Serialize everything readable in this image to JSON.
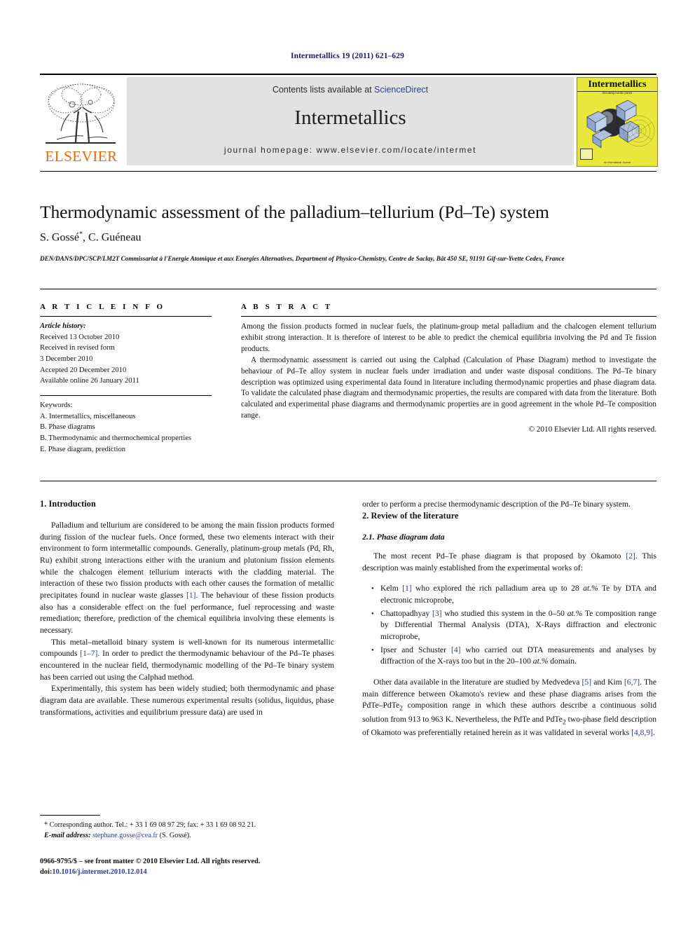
{
  "running_head": "Intermetallics 19 (2011) 621–629",
  "masthead": {
    "publisher_name": "ELSEVIER",
    "contents_prefix": "Contents lists available at ",
    "contents_link": "ScienceDirect",
    "journal_title": "Intermetallics",
    "homepage": "journal homepage: www.elsevier.com/locate/intermet",
    "cover": {
      "title": "Intermetallics",
      "subtitle": "including nordic pores",
      "footer": "An International Journal"
    },
    "link_color": "#2b3f9c",
    "banner_color": "#e2e2e2",
    "cover_color": "#e9e73c",
    "elsevier_orange": "#ec6608"
  },
  "article": {
    "title": "Thermodynamic assessment of the palladium–tellurium (Pd–Te) system",
    "authors": "S. Gossé",
    "authors_star": "*",
    "authors_rest": ", C. Guéneau",
    "affiliation": "DEN/DANS/DPC/SCP/LM2T Commissariat à l'Energie Atomique et aux Energies Alternatives, Department of Physico-Chemistry, Centre de Saclay, Bât 450 SE, 91191 Gif-sur-Yvette Cedex, France"
  },
  "info": {
    "heading": "A R T I C L E   I N F O",
    "history_label": "Article history:",
    "history": [
      "Received 13 October 2010",
      "Received in revised form",
      "3 December 2010",
      "Accepted 20 December 2010",
      "Available online 26 January 2011"
    ],
    "keywords_label": "Keywords:",
    "keywords": [
      "A. Intermetallics, miscellaneous",
      "B. Phase diagrams",
      "B. Thermodynamic and thermochemical properties",
      "E. Phase diagram, prediction"
    ]
  },
  "abstract": {
    "heading": "A B S T R A C T",
    "paragraphs": [
      "Among the fission products formed in nuclear fuels, the platinum-group metal palladium and the chalcogen element tellurium exhibit strong interaction. It is therefore of interest to be able to predict the chemical equilibria involving the Pd and Te fission products.",
      "A thermodynamic assessment is carried out using the Calphad (Calculation of Phase Diagram) method to investigate the behaviour of Pd–Te alloy system in nuclear fuels under irradiation and under waste disposal conditions. The Pd–Te binary description was optimized using experimental data found in literature including thermodynamic properties and phase diagram data. To validate the calculated phase diagram and thermodynamic properties, the results are compared with data from the literature. Both calculated and experimental phase diagrams and thermodynamic properties are in good agreement in the whole Pd–Te composition range."
    ],
    "copyright": "© 2010 Elsevier Ltd. All rights reserved."
  },
  "body": {
    "left": {
      "section1_heading": "1.  Introduction",
      "para1_a": "Palladium and tellurium are considered to be among the main fission products formed during fission of the nuclear fuels. Once formed, these two elements interact with their environment to form intermetallic compounds. Generally, platinum-group metals (Pd, Rh, Ru) exhibit strong interactions either with the uranium and plutonium fission elements while the chalcogen element tellurium interacts with the cladding material. The interaction of these two fission products with each other causes the formation of metallic precipitates found in nuclear waste glasses ",
      "para1_ref1": "[1]",
      "para1_b": ". The behaviour of these fission products also has a considerable effect on the fuel performance, fuel reprocessing and waste remediation; therefore, prediction of the chemical equilibria involving these elements is necessary.",
      "para2_a": "This metal–metalloid binary system is well-known for its numerous intermetallic compounds ",
      "para2_ref": "[1–7]",
      "para2_b": ". In order to predict the thermodynamic behaviour of the Pd–Te phases encountered in the nuclear field, thermodynamic modelling of the Pd–Te binary system has been carried out using the Calphad method.",
      "para3": "Experimentally, this system has been widely studied; both thermodynamic and phase diagram data are available. These numerous experimental results (solidus, liquidus, phase transformations, activities and equilibrium pressure data) are used in"
    },
    "right": {
      "para_cont": "order to perform a precise thermodynamic description of the Pd–Te binary system.",
      "section2_heading": "2.  Review of the literature",
      "section21_heading": "2.1.  Phase diagram data",
      "para_a": "The most recent Pd–Te phase diagram is that proposed by Okamoto ",
      "para_a_ref": "[2]",
      "para_a_b": ". This description was mainly established from the experimental works of:",
      "bullets": [
        {
          "pre": "Kelm ",
          "ref": "[1]",
          "post": " who explored the rich palladium area up to 28 ",
          "italic": "at.%",
          "tail": " Te by DTA and electronic microprobe,"
        },
        {
          "pre": "Chattopadhyay ",
          "ref": "[3]",
          "post": " who studied this system in the 0–50 ",
          "italic": "at.%",
          "tail": " Te composition range by Differential Thermal Analysis (DTA), X-Rays diffraction and electronic microprobe,"
        },
        {
          "pre": "Ipser and Schuster ",
          "ref": "[4]",
          "post": " who carried out DTA measurements and analyses by diffraction of the X-rays too but in the 20–100 ",
          "italic": "at.%",
          "tail": " domain."
        }
      ],
      "para_b_a": "Other data available in the literature are studied by Medvedeva ",
      "para_b_ref1": "[5]",
      "para_b_mid": " and Kim ",
      "para_b_ref2": "[6,7]",
      "para_b_end_1": ". The main difference between Okamoto's review and these phase diagrams arises from the PdTe–PdTe",
      "para_b_sub1": "2",
      "para_b_end_2": " composition range in which these authors describe a continuous solid solution from 913 to 963 K. Nevertheless, the PdTe and PdTe",
      "para_b_sub2": "2",
      "para_b_end_3": " two-phase field description of Okamoto was preferentially retained herein as it was validated in several works ",
      "para_b_ref3": "[4,8,9]",
      "para_b_end_4": "."
    }
  },
  "footnote": {
    "line1": "* Corresponding author. Tel.: + 33 1 69 08 97 29; fax: + 33 1 69 08 92 21.",
    "email_label": "E-mail address:",
    "email": "stephane.gosse@cea.fr",
    "email_suffix": " (S. Gossé)."
  },
  "footer": {
    "line1": "0966-9795/$ – see front matter © 2010 Elsevier Ltd. All rights reserved.",
    "doi_label": "doi:",
    "doi": "10.1016/j.intermet.2010.12.014"
  }
}
